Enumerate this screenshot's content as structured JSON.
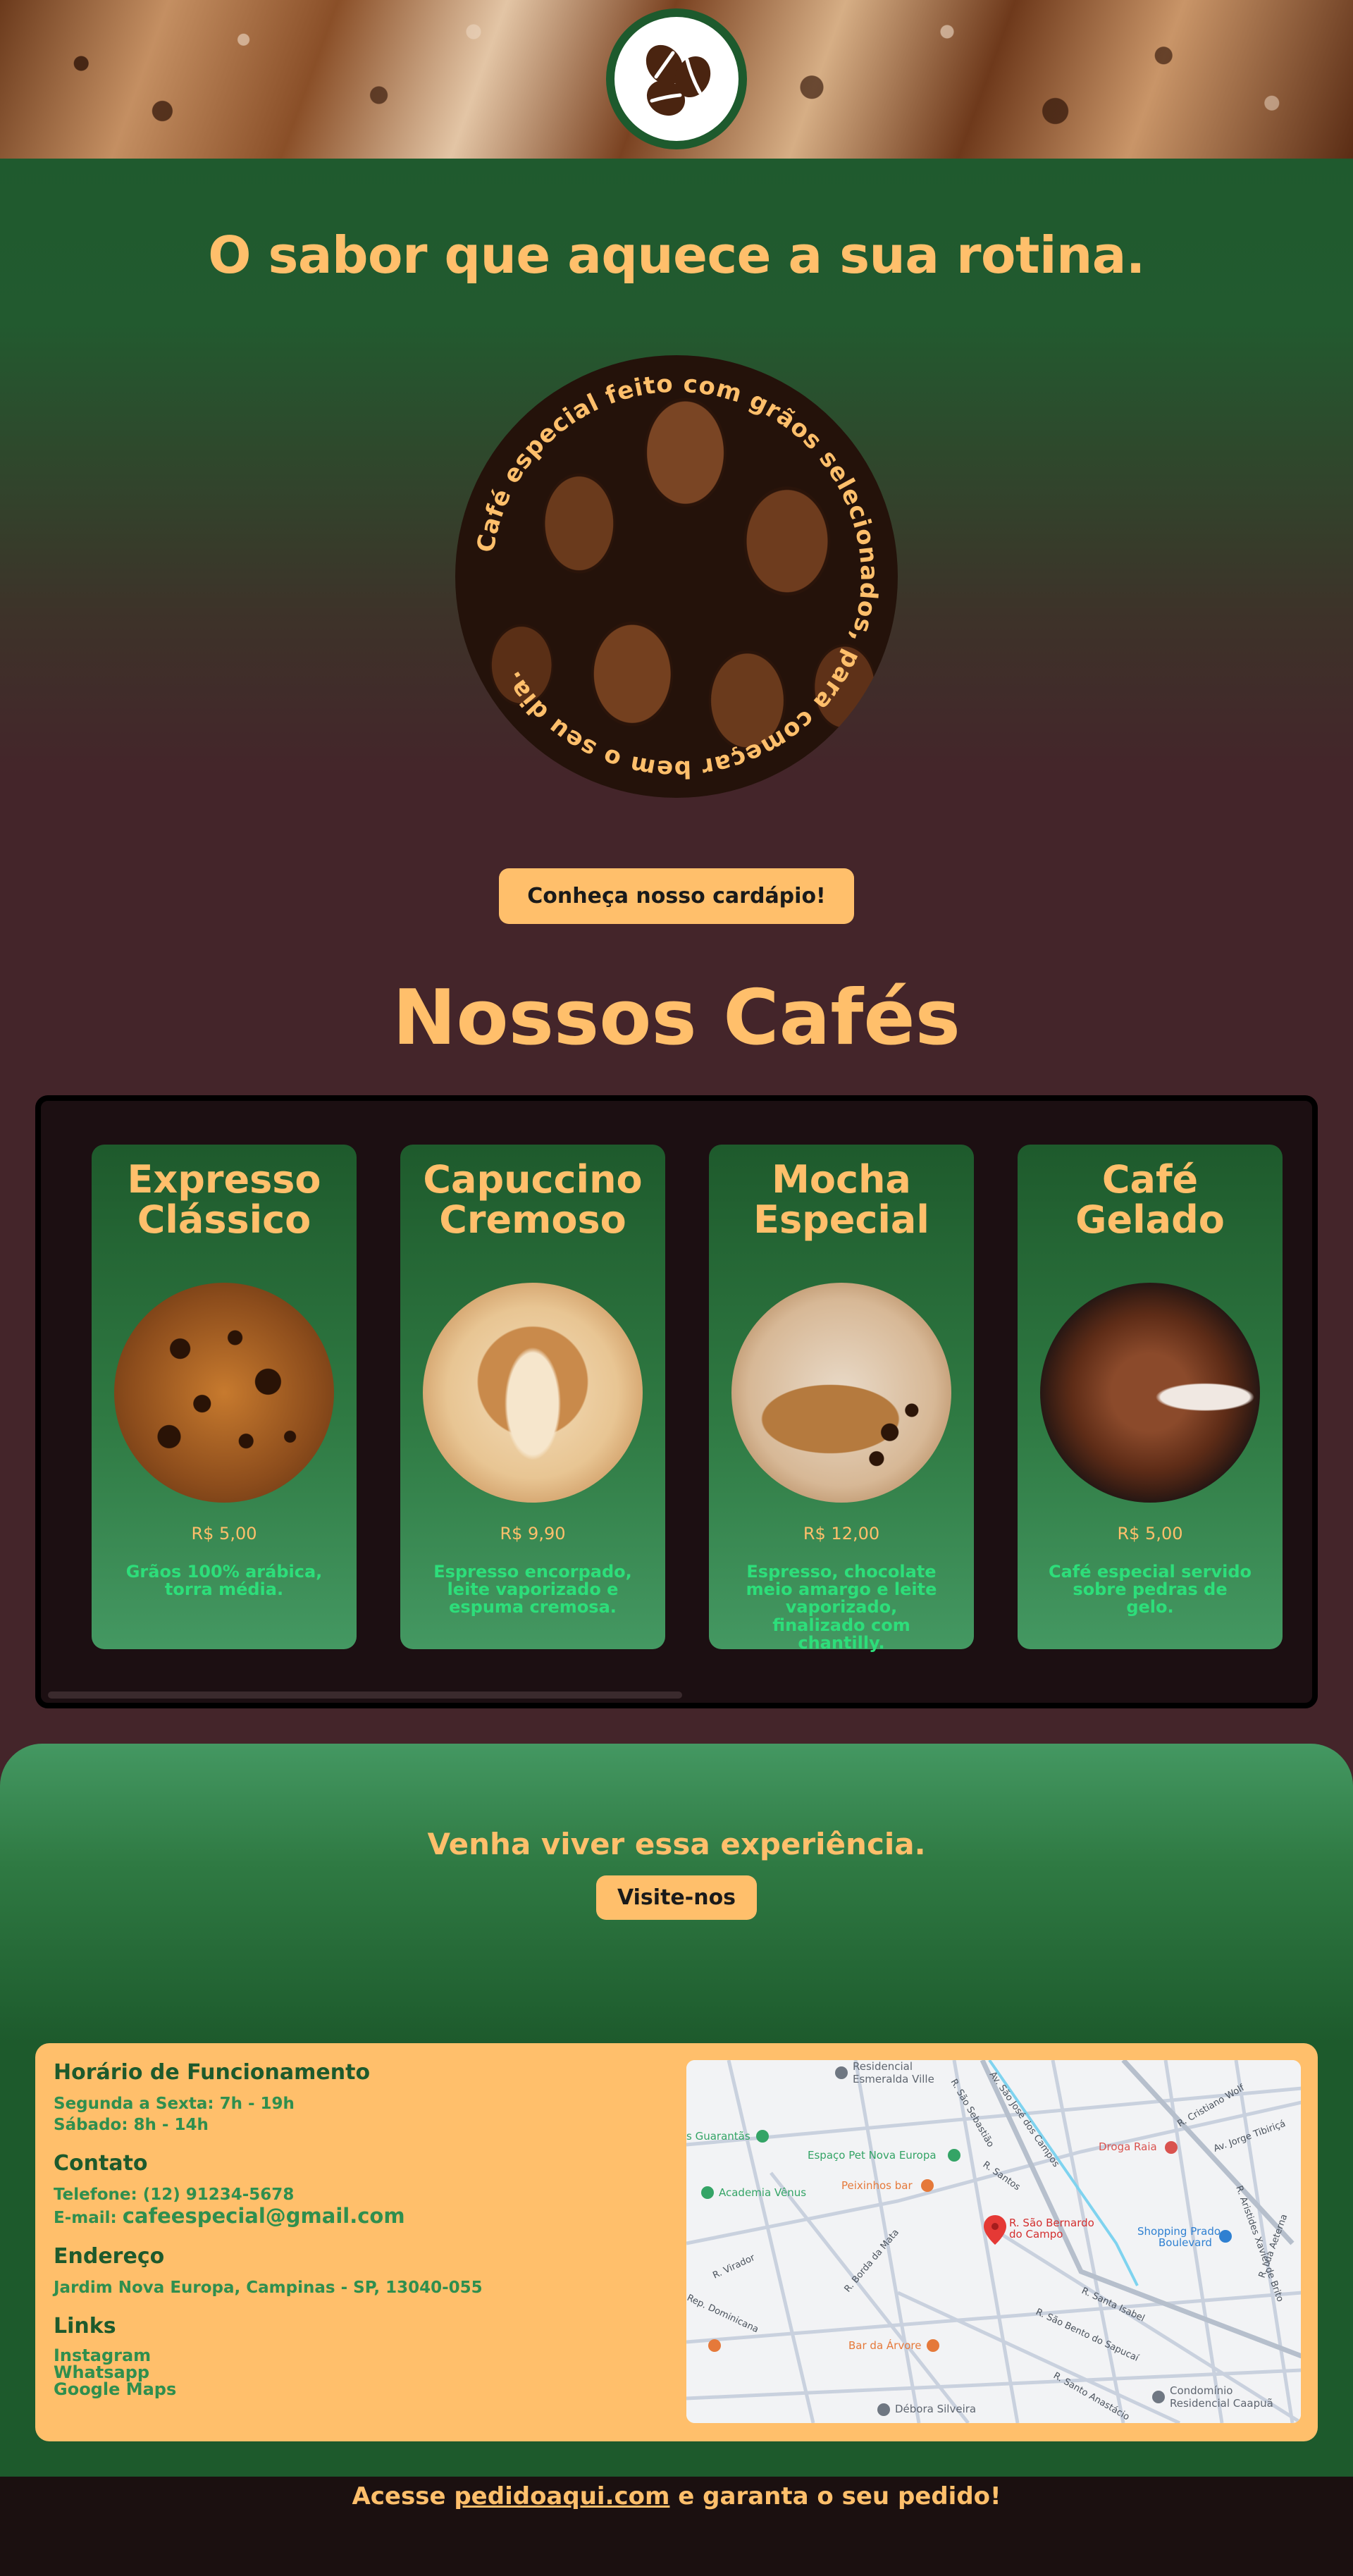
{
  "hero": {
    "title": "O sabor que aquece a sua rotina.",
    "ring_text": "Café especial feito com grãos selecionados, para começar bem o seu dia.",
    "menu_button": "Conheça nosso cardápio!"
  },
  "coffees": {
    "section_title": "Nossos Cafés",
    "items": [
      {
        "title_line1": "Expresso",
        "title_line2": "Clássico",
        "price": "R$ 5,00",
        "description": "Grãos 100% arábica, torra média."
      },
      {
        "title_line1": "Capuccino",
        "title_line2": "Cremoso",
        "price": "R$ 9,90",
        "description": "Espresso encorpado, leite vaporizado e espuma cremosa."
      },
      {
        "title_line1": "Mocha",
        "title_line2": "Especial",
        "price": "R$ 12,00",
        "description": "Espresso, chocolate meio amargo e leite vaporizado, finalizado com chantilly."
      },
      {
        "title_line1": "Café",
        "title_line2": "Gelado",
        "price": "R$ 5,00",
        "description": "Café especial servido sobre pedras de gelo."
      }
    ]
  },
  "visit": {
    "text": "Venha viver essa experiência.",
    "button": "Visite-nos"
  },
  "info": {
    "hours_title": "Horário de Funcionamento",
    "hours_line1": "Segunda a Sexta: 7h - 19h",
    "hours_line2": "Sábado: 8h - 14h",
    "contact_title": "Contato",
    "phone": "Telefone: (12) 91234-5678",
    "email_label": "E-mail:",
    "email": "cafeespecial@gmail.com",
    "address_title": "Endereço",
    "address": "Jardim Nova Europa, Campinas - SP, 13040-055",
    "links_title": "Links",
    "links": [
      "Instagram",
      "Whatsapp",
      "Google Maps"
    ]
  },
  "map": {
    "labels": {
      "residencial": "Residencial",
      "esmeralda": "Esmeralda Ville",
      "guarantas": "s Guarantãs",
      "espaco_pet": "Espaço Pet Nova Europa",
      "academia": "Academia Vênus",
      "peixinhos": "Peixinhos bar",
      "droga_raia": "Droga Raia",
      "sao_bernardo1": "R. São Bernardo",
      "sao_bernardo2": "do Campo",
      "shopping1": "Shopping Prado",
      "shopping2": "Boulevard",
      "bar_arvore": "Bar da Árvore",
      "debora": "Débora Silveira",
      "condominio1": "Condomínio",
      "condominio2": "Residencial Caapuã",
      "r_virador": "R. Virador",
      "r_borda_mata": "R. Borda da Mata",
      "r_santa_isabel": "R. Santa Isabel",
      "r_sao_bento": "R. São Bento do Sapucaí",
      "r_santos": "R. Santos",
      "r_jorge": "Av. Jorge Tibiriçá",
      "r_cristiano": "R. Cristiano Wolf",
      "r_sao_sebastiao": "R. São Sebastião",
      "av_sao_jose": "Av. São José dos Campos",
      "r_santo_anastacio": "R. Santo Anastácio",
      "r_lua_aeterna": "R. Lua Aeterna",
      "r_dominicana": "Rep. Dominicana",
      "r_xavier": "R. Aristides Xavier de Brito"
    }
  },
  "footer": {
    "prefix": "Acesse",
    "link": "pedidoaqui.com",
    "suffix": "e garanta o seu pedido!"
  }
}
